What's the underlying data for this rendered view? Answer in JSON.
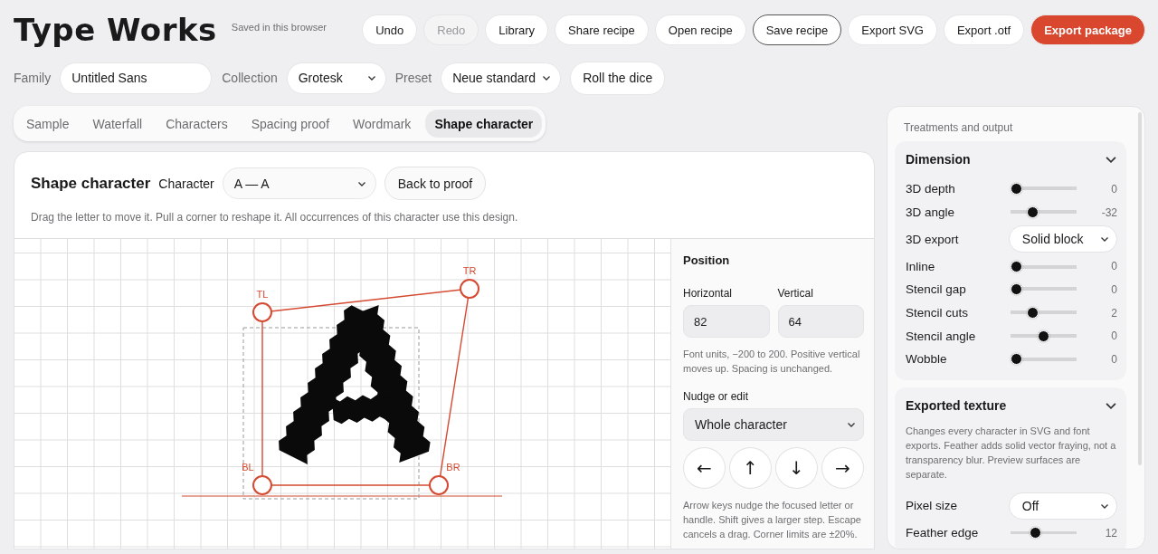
{
  "app": {
    "title": "Type Works",
    "save_status": "Saved in this browser"
  },
  "toolbar": [
    {
      "label": "Undo",
      "kind": "plain",
      "disabled": false
    },
    {
      "label": "Redo",
      "kind": "plain",
      "disabled": true
    },
    {
      "label": "Library",
      "kind": "plain",
      "disabled": false
    },
    {
      "label": "Share recipe",
      "kind": "plain",
      "disabled": false
    },
    {
      "label": "Open recipe",
      "kind": "plain",
      "disabled": false
    },
    {
      "label": "Save recipe",
      "kind": "outlined",
      "disabled": false
    },
    {
      "label": "Export SVG",
      "kind": "plain",
      "disabled": false
    },
    {
      "label": "Export .otf",
      "kind": "plain",
      "disabled": false
    },
    {
      "label": "Export package",
      "kind": "primary",
      "disabled": false
    }
  ],
  "settings": {
    "family_label": "Family",
    "family_value": "Untitled Sans",
    "collection_label": "Collection",
    "collection_value": "Grotesk",
    "preset_label": "Preset",
    "preset_value": "Neue standard",
    "dice_button": "Roll the dice"
  },
  "tabs": [
    {
      "label": "Sample",
      "selected": false
    },
    {
      "label": "Waterfall",
      "selected": false
    },
    {
      "label": "Characters",
      "selected": false
    },
    {
      "label": "Spacing proof",
      "selected": false
    },
    {
      "label": "Wordmark",
      "selected": false
    },
    {
      "label": "Shape character",
      "selected": true
    }
  ],
  "editor": {
    "title": "Shape character",
    "character_label": "Character",
    "character_value": "A — A",
    "back_button": "Back to proof",
    "hint": "Drag the letter to move it. Pull a corner to reshape it. All occurrences of this character use this design.",
    "handles": [
      {
        "label": "TL"
      },
      {
        "label": "TR"
      },
      {
        "label": "BL"
      },
      {
        "label": "BR"
      }
    ],
    "position": {
      "title": "Position",
      "horizontal_label": "Horizontal",
      "horizontal_value": "82",
      "vertical_label": "Vertical",
      "vertical_value": "64",
      "note": "Font units, −200 to 200. Positive vertical moves up. Spacing is unchanged.",
      "nudge_label": "Nudge or edit",
      "nudge_value": "Whole character",
      "arrows": [
        "←",
        "↑",
        "↓",
        "→"
      ],
      "footnote": "Arrow keys nudge the focused letter or handle. Shift gives a larger step. Escape cancels a drag. Corner limits are ±20%."
    }
  },
  "panel": {
    "title": "Treatments and output",
    "sections": [
      {
        "title": "Dimension",
        "expanded": true,
        "rows": [
          {
            "kind": "slider",
            "label": "3D depth",
            "level": 0,
            "reading": "0"
          },
          {
            "kind": "slider",
            "label": "3D angle",
            "level": 0.3,
            "reading": "-32"
          },
          {
            "kind": "select",
            "label": "3D export",
            "value": "Solid block"
          },
          {
            "kind": "slider",
            "label": "Inline",
            "level": 0,
            "reading": "0"
          },
          {
            "kind": "slider",
            "label": "Stencil gap",
            "level": 0,
            "reading": "0"
          },
          {
            "kind": "slider",
            "label": "Stencil cuts",
            "level": 0.3,
            "reading": "2"
          },
          {
            "kind": "slider",
            "label": "Stencil angle",
            "level": 0.5,
            "reading": "0"
          },
          {
            "kind": "slider",
            "label": "Wobble",
            "level": 0,
            "reading": "0"
          }
        ]
      },
      {
        "title": "Exported texture",
        "expanded": true,
        "description": "Changes every character in SVG and font exports. Feather adds solid vector fraying, not a transparency blur. Preview surfaces are separate.",
        "rows": [
          {
            "kind": "select",
            "label": "Pixel size",
            "value": "Off"
          },
          {
            "kind": "slider",
            "label": "Feather edge",
            "level": 0.35,
            "reading": "12"
          }
        ]
      }
    ]
  }
}
